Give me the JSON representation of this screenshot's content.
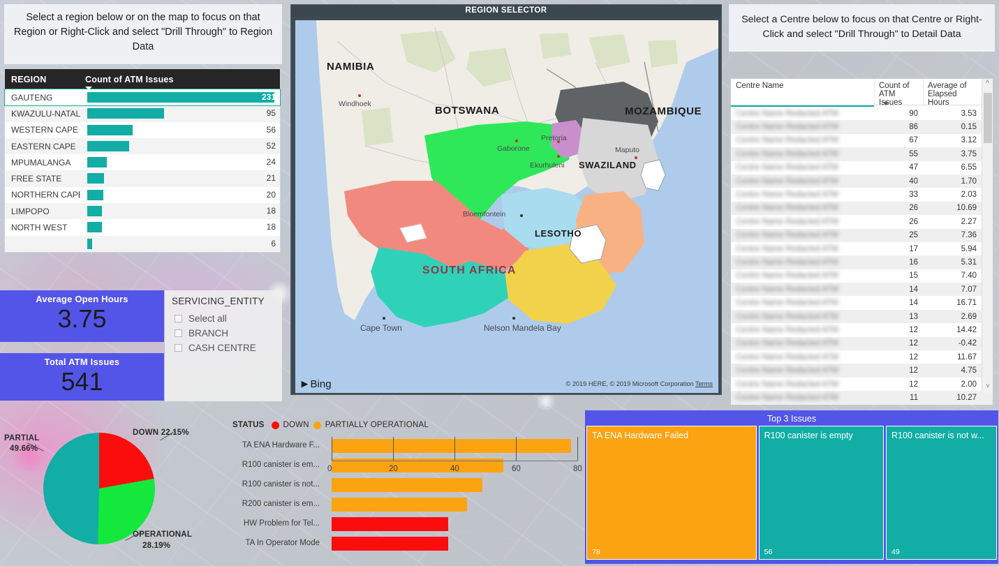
{
  "region_panel": {
    "instruction": "Select a region below or on the map to focus on that Region or Right-Click and select \"Drill Through\" to Region Data",
    "columns": [
      "REGION",
      "Count of ATM Issues"
    ],
    "rows": [
      {
        "region": "GAUTENG",
        "count": 231
      },
      {
        "region": "KWAZULU-NATAL",
        "count": 95
      },
      {
        "region": "WESTERN CAPE",
        "count": 56
      },
      {
        "region": "EASTERN CAPE",
        "count": 52
      },
      {
        "region": "MPUMALANGA",
        "count": 24
      },
      {
        "region": "FREE STATE",
        "count": 21
      },
      {
        "region": "NORTHERN CAPE",
        "count": 20
      },
      {
        "region": "LIMPOPO",
        "count": 18
      },
      {
        "region": "NORTH WEST",
        "count": 18
      },
      {
        "region": "",
        "count": 6
      }
    ]
  },
  "kpi": {
    "open_hours_title": "Average Open Hours",
    "open_hours_value": "3.75",
    "total_issues_title": "Total ATM Issues",
    "total_issues_value": "541"
  },
  "slicer": {
    "title": "SERVICING_ENTITY",
    "items": [
      "Select all",
      "BRANCH",
      "CASH CENTRE"
    ]
  },
  "map": {
    "title": "REGION SELECTOR",
    "bing_label": "Bing",
    "attribution": "© 2019 HERE, © 2019 Microsoft Corporation",
    "terms_label": "Terms",
    "countries": [
      "NAMIBIA",
      "BOTSWANA",
      "MOZAMBIQUE",
      "SWAZILAND",
      "LESOTHO",
      "SOUTH AFRICA"
    ],
    "cities": [
      "Windhoek",
      "Gaborone",
      "Pretoria",
      "Maputo",
      "Ekurhuleni",
      "Bloemfontein",
      "Cape Town",
      "Nelson Mandela Bay"
    ]
  },
  "centre_panel": {
    "instruction": "Select a Centre below to focus on that Centre or Right-Click and select \"Drill Through\" to Detail Data",
    "columns": [
      "Centre Name",
      "Count of ATM Issues",
      "Average of Elapsed Hours"
    ],
    "rows": [
      {
        "name": "",
        "count": 90,
        "avg": "3.53"
      },
      {
        "name": "",
        "count": 86,
        "avg": "0.15"
      },
      {
        "name": "",
        "count": 67,
        "avg": "3.12"
      },
      {
        "name": "",
        "count": 55,
        "avg": "3.75"
      },
      {
        "name": "",
        "count": 47,
        "avg": "6.55"
      },
      {
        "name": "",
        "count": 40,
        "avg": "1.70"
      },
      {
        "name": "",
        "count": 33,
        "avg": "2.03"
      },
      {
        "name": "",
        "count": 26,
        "avg": "10.69"
      },
      {
        "name": "",
        "count": 26,
        "avg": "2.27"
      },
      {
        "name": "",
        "count": 25,
        "avg": "7.36"
      },
      {
        "name": "",
        "count": 17,
        "avg": "5.94"
      },
      {
        "name": "",
        "count": 16,
        "avg": "5.31"
      },
      {
        "name": "",
        "count": 15,
        "avg": "7.40"
      },
      {
        "name": "",
        "count": 14,
        "avg": "7.07"
      },
      {
        "name": "",
        "count": 14,
        "avg": "16.71"
      },
      {
        "name": "",
        "count": 13,
        "avg": "2.69"
      },
      {
        "name": "",
        "count": 12,
        "avg": "14.42"
      },
      {
        "name": "",
        "count": 12,
        "avg": "-0.42"
      },
      {
        "name": "",
        "count": 12,
        "avg": "11.67"
      },
      {
        "name": "",
        "count": 12,
        "avg": "4.75"
      },
      {
        "name": "",
        "count": 12,
        "avg": "2.00"
      },
      {
        "name": "",
        "count": 11,
        "avg": "10.27"
      }
    ]
  },
  "colors": {
    "accent_teal": "#12ada5",
    "kpi_blue": "#5355e8",
    "status_down": "#fb0d0d",
    "status_partial": "#fca311",
    "status_operational": "#15e83d"
  },
  "chart_data": [
    {
      "type": "pie",
      "title": "",
      "labels": [
        "DOWN",
        "OPERATIONAL",
        "PARTIAL"
      ],
      "values": [
        22.15,
        28.19,
        49.66
      ],
      "value_suffix": "%",
      "annotations": [
        "DOWN 22.15%",
        "OPERATIONAL 28.19%",
        "PARTIAL 49.66%"
      ],
      "colors": [
        "#fb0d0d",
        "#15e83d",
        "#12ada5"
      ],
      "legend": "none"
    },
    {
      "type": "bar",
      "orientation": "horizontal",
      "title": "",
      "legend_title": "STATUS",
      "legend": [
        {
          "name": "DOWN",
          "color": "#fb0d0d"
        },
        {
          "name": "PARTIALLY OPERATIONAL",
          "color": "#fca311"
        }
      ],
      "categories": [
        "TA ENA Hardware F...",
        "R100 canister is em...",
        "R100 canister is not...",
        "R200 canister is em...",
        "HW Problem for Tel...",
        "TA In Operator Mode"
      ],
      "values": [
        78,
        56,
        49,
        44,
        38,
        38
      ],
      "bar_colors": [
        "#fca311",
        "#fca311",
        "#fca311",
        "#fca311",
        "#fb0d0d",
        "#fb0d0d"
      ],
      "xlabel": "",
      "ylabel": "",
      "xlim": [
        0,
        80
      ],
      "xticks": [
        0,
        20,
        40,
        60,
        80
      ],
      "grid": true
    },
    {
      "type": "treemap",
      "title": "Top 3 Issues",
      "categories": [
        "TA ENA Hardware Failed",
        "R100 canister is empty",
        "R100 canister is not w..."
      ],
      "values": [
        78,
        56,
        49
      ],
      "colors": [
        "#fca311",
        "#12ada5",
        "#12ada5"
      ]
    }
  ]
}
